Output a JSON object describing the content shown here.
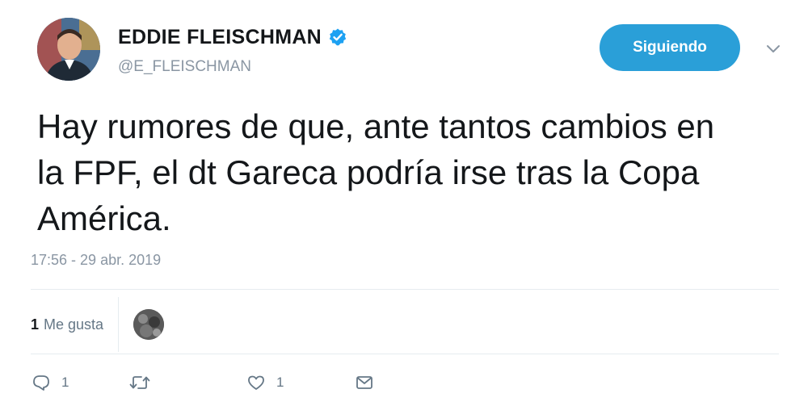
{
  "author": {
    "name": "EDDIE FLEISCHMAN",
    "handle": "@E_FLEISCHMAN",
    "verified": true
  },
  "follow_button": {
    "label": "Siguiendo"
  },
  "tweet": {
    "text_lines": [
      "Hay rumores de que, ante tantos cambios en",
      "la FPF, el dt Gareca podría irse tras la Copa",
      "América."
    ],
    "timestamp": "17:56 - 29 abr. 2019"
  },
  "likes": {
    "count": "1",
    "label": "Me gusta"
  },
  "actions": {
    "reply_count": "1",
    "retweet_count": "",
    "like_count": "1"
  },
  "icons": {
    "verified": "verified-badge-icon",
    "more": "chevron-down-icon",
    "reply": "reply-icon",
    "retweet": "retweet-icon",
    "like": "heart-icon",
    "message": "envelope-icon"
  },
  "colors": {
    "accent": "#2a9fd8",
    "text": "#14171a",
    "muted": "#8a96a3",
    "divider": "#e6ecf0"
  }
}
